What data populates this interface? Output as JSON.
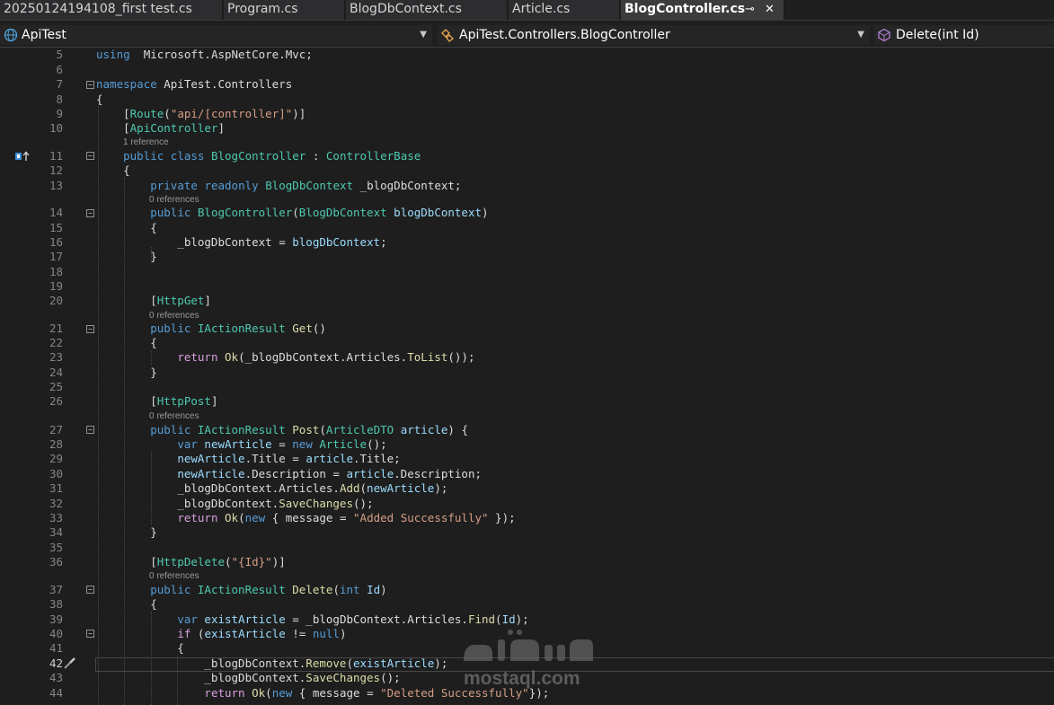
{
  "tabs": [
    {
      "label": "20250124194108_first test.cs",
      "active": false
    },
    {
      "label": "Program.cs",
      "active": false
    },
    {
      "label": "BlogDbContext.cs",
      "active": false
    },
    {
      "label": "Article.cs",
      "active": false
    },
    {
      "label": "BlogController.cs",
      "active": true
    }
  ],
  "navbar": {
    "project": "ApiTest",
    "type": "ApiTest.Controllers.BlogController",
    "member": "Delete(int Id)"
  },
  "lens": {
    "l10": "1 reference",
    "l13": "0 references",
    "l20": "0 references",
    "l26": "0 references",
    "l36": "0 references"
  },
  "watermark": {
    "arabic": "مستقل",
    "latin": "mostaql.com"
  },
  "lines": [
    {
      "n": "5",
      "tokens": [
        [
          "kw",
          "using"
        ],
        [
          "",
          "  Microsoft.AspNetCore.Mvc;"
        ]
      ]
    },
    {
      "n": "6",
      "tokens": []
    },
    {
      "n": "7",
      "tokens": [
        [
          "kw",
          "namespace"
        ],
        [
          "",
          " ApiTest.Controllers"
        ]
      ]
    },
    {
      "n": "8",
      "tokens": [
        [
          "",
          "{"
        ]
      ]
    },
    {
      "n": "9",
      "tokens": [
        [
          "",
          "    ["
        ],
        [
          "ty",
          "Route"
        ],
        [
          "",
          "("
        ],
        [
          "str",
          "\"api/[controller]\""
        ],
        [
          "",
          ")]"
        ]
      ]
    },
    {
      "n": "10",
      "tokens": [
        [
          "",
          "    ["
        ],
        [
          "ty",
          "ApiController"
        ],
        [
          "",
          "]"
        ]
      ]
    },
    {
      "n": "11",
      "tokens": [
        [
          "",
          "    "
        ],
        [
          "kw",
          "public"
        ],
        [
          "",
          " "
        ],
        [
          "kw",
          "class"
        ],
        [
          "",
          " "
        ],
        [
          "ty",
          "BlogController"
        ],
        [
          "",
          " : "
        ],
        [
          "ty",
          "ControllerBase"
        ]
      ]
    },
    {
      "n": "12",
      "tokens": [
        [
          "",
          "    {"
        ]
      ]
    },
    {
      "n": "13",
      "tokens": [
        [
          "",
          "        "
        ],
        [
          "kw",
          "private"
        ],
        [
          "",
          " "
        ],
        [
          "kw",
          "readonly"
        ],
        [
          "",
          " "
        ],
        [
          "ty",
          "BlogDbContext"
        ],
        [
          "",
          " _blogDbContext;"
        ]
      ]
    },
    {
      "n": "14",
      "tokens": [
        [
          "",
          "        "
        ],
        [
          "kw",
          "public"
        ],
        [
          "",
          " "
        ],
        [
          "ty",
          "BlogController"
        ],
        [
          "",
          "("
        ],
        [
          "ty",
          "BlogDbContext"
        ],
        [
          "",
          " "
        ],
        [
          "var",
          "blogDbContext"
        ],
        [
          "",
          ")"
        ]
      ]
    },
    {
      "n": "15",
      "tokens": [
        [
          "",
          "        {"
        ]
      ]
    },
    {
      "n": "16",
      "tokens": [
        [
          "",
          "            _blogDbContext = "
        ],
        [
          "var",
          "blogDbContext"
        ],
        [
          "",
          ";"
        ]
      ]
    },
    {
      "n": "17",
      "tokens": [
        [
          "",
          "        }"
        ]
      ]
    },
    {
      "n": "18",
      "tokens": []
    },
    {
      "n": "19",
      "tokens": []
    },
    {
      "n": "20",
      "tokens": [
        [
          "",
          "        ["
        ],
        [
          "ty",
          "HttpGet"
        ],
        [
          "",
          "]"
        ]
      ]
    },
    {
      "n": "21",
      "tokens": [
        [
          "",
          "        "
        ],
        [
          "kw",
          "public"
        ],
        [
          "",
          " "
        ],
        [
          "ty",
          "IActionResult"
        ],
        [
          "",
          " "
        ],
        [
          "fn",
          "Get"
        ],
        [
          "",
          "()"
        ]
      ]
    },
    {
      "n": "22",
      "tokens": [
        [
          "",
          "        {"
        ]
      ]
    },
    {
      "n": "23",
      "tokens": [
        [
          "",
          "            "
        ],
        [
          "ctl",
          "return"
        ],
        [
          "",
          " "
        ],
        [
          "fn",
          "Ok"
        ],
        [
          "",
          "(_blogDbContext.Articles."
        ],
        [
          "fn",
          "ToList"
        ],
        [
          "",
          "());"
        ]
      ]
    },
    {
      "n": "24",
      "tokens": [
        [
          "",
          "        }"
        ]
      ]
    },
    {
      "n": "25",
      "tokens": []
    },
    {
      "n": "26",
      "tokens": [
        [
          "",
          "        ["
        ],
        [
          "ty",
          "HttpPost"
        ],
        [
          "",
          "]"
        ]
      ]
    },
    {
      "n": "27",
      "tokens": [
        [
          "",
          "        "
        ],
        [
          "kw",
          "public"
        ],
        [
          "",
          " "
        ],
        [
          "ty",
          "IActionResult"
        ],
        [
          "",
          " "
        ],
        [
          "fn",
          "Post"
        ],
        [
          "",
          "("
        ],
        [
          "ty",
          "ArticleDTO"
        ],
        [
          "",
          " "
        ],
        [
          "var",
          "article"
        ],
        [
          "",
          ") {"
        ]
      ]
    },
    {
      "n": "28",
      "tokens": [
        [
          "",
          "            "
        ],
        [
          "kw",
          "var"
        ],
        [
          "",
          " "
        ],
        [
          "var",
          "newArticle"
        ],
        [
          "",
          " = "
        ],
        [
          "kw",
          "new"
        ],
        [
          "",
          " "
        ],
        [
          "ty",
          "Article"
        ],
        [
          "",
          "();"
        ]
      ]
    },
    {
      "n": "29",
      "tokens": [
        [
          "",
          "            "
        ],
        [
          "var",
          "newArticle"
        ],
        [
          "",
          ".Title = "
        ],
        [
          "var",
          "article"
        ],
        [
          "",
          ".Title;"
        ]
      ]
    },
    {
      "n": "30",
      "tokens": [
        [
          "",
          "            "
        ],
        [
          "var",
          "newArticle"
        ],
        [
          "",
          ".Description = "
        ],
        [
          "var",
          "article"
        ],
        [
          "",
          ".Description;"
        ]
      ]
    },
    {
      "n": "31",
      "tokens": [
        [
          "",
          "            _blogDbContext.Articles."
        ],
        [
          "fn",
          "Add"
        ],
        [
          "",
          "("
        ],
        [
          "var",
          "newArticle"
        ],
        [
          "",
          ");"
        ]
      ]
    },
    {
      "n": "32",
      "tokens": [
        [
          "",
          "            _blogDbContext."
        ],
        [
          "fn",
          "SaveChanges"
        ],
        [
          "",
          "();"
        ]
      ]
    },
    {
      "n": "33",
      "tokens": [
        [
          "",
          "            "
        ],
        [
          "ctl",
          "return"
        ],
        [
          "",
          " "
        ],
        [
          "fn",
          "Ok"
        ],
        [
          "",
          "("
        ],
        [
          "kw",
          "new"
        ],
        [
          "",
          " { message = "
        ],
        [
          "str",
          "\"Added Successfully\""
        ],
        [
          "",
          " });"
        ]
      ]
    },
    {
      "n": "34",
      "tokens": [
        [
          "",
          "        }"
        ]
      ]
    },
    {
      "n": "35",
      "tokens": []
    },
    {
      "n": "36",
      "tokens": [
        [
          "",
          "        ["
        ],
        [
          "ty",
          "HttpDelete"
        ],
        [
          "",
          "("
        ],
        [
          "str",
          "\"{Id}\""
        ],
        [
          "",
          ")]"
        ]
      ]
    },
    {
      "n": "37",
      "tokens": [
        [
          "",
          "        "
        ],
        [
          "kw",
          "public"
        ],
        [
          "",
          " "
        ],
        [
          "ty",
          "IActionResult"
        ],
        [
          "",
          " "
        ],
        [
          "fn",
          "Delete"
        ],
        [
          "",
          "("
        ],
        [
          "kw",
          "int"
        ],
        [
          "",
          " "
        ],
        [
          "var",
          "Id"
        ],
        [
          "",
          ")"
        ]
      ]
    },
    {
      "n": "38",
      "tokens": [
        [
          "",
          "        {"
        ]
      ]
    },
    {
      "n": "39",
      "tokens": [
        [
          "",
          "            "
        ],
        [
          "kw",
          "var"
        ],
        [
          "",
          " "
        ],
        [
          "var",
          "existArticle"
        ],
        [
          "",
          " = _blogDbContext.Articles."
        ],
        [
          "fn",
          "Find"
        ],
        [
          "",
          "("
        ],
        [
          "var",
          "Id"
        ],
        [
          "",
          ");"
        ]
      ]
    },
    {
      "n": "40",
      "tokens": [
        [
          "",
          "            "
        ],
        [
          "ctl",
          "if"
        ],
        [
          "",
          " ("
        ],
        [
          "var",
          "existArticle"
        ],
        [
          "",
          " != "
        ],
        [
          "kw",
          "null"
        ],
        [
          "",
          ")"
        ]
      ]
    },
    {
      "n": "41",
      "tokens": [
        [
          "",
          "            {"
        ]
      ]
    },
    {
      "n": "42",
      "tokens": [
        [
          "",
          "                _blogDbContext."
        ],
        [
          "fn",
          "Remove"
        ],
        [
          "",
          "("
        ],
        [
          "var",
          "existArticle"
        ],
        [
          "",
          ");"
        ]
      ]
    },
    {
      "n": "43",
      "tokens": [
        [
          "",
          "                _blogDbContext."
        ],
        [
          "fn",
          "SaveChanges"
        ],
        [
          "",
          "();"
        ]
      ]
    },
    {
      "n": "44",
      "tokens": [
        [
          "",
          "                "
        ],
        [
          "ctl",
          "return"
        ],
        [
          "",
          " "
        ],
        [
          "fn",
          "Ok"
        ],
        [
          "",
          "("
        ],
        [
          "kw",
          "new"
        ],
        [
          "",
          " { message = "
        ],
        [
          "str",
          "\"Deleted Successfully\""
        ],
        [
          "",
          "});"
        ]
      ]
    }
  ]
}
